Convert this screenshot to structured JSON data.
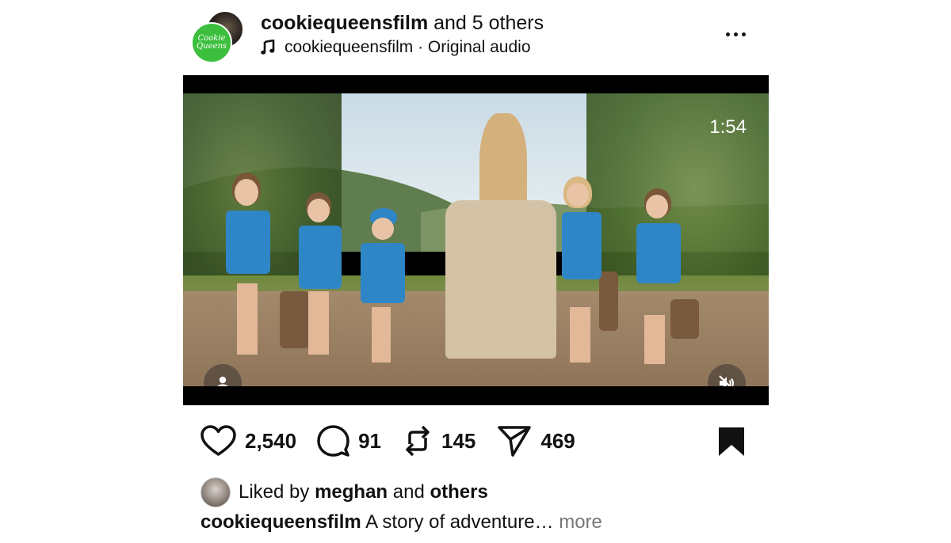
{
  "post": {
    "author": "cookiequeensfilm",
    "collab_suffix": "and 5 others",
    "audio_text": "cookiequeensfilm · Original audio",
    "brand_avatar_text": "Cookie Queens",
    "menu_icon": "more-horizontal-icon"
  },
  "video": {
    "duration": "1:54",
    "profile_icon": "person-icon",
    "mute_icon": "speaker-muted-icon"
  },
  "actions": {
    "likes": "2,540",
    "comments": "91",
    "reposts": "145",
    "shares": "469"
  },
  "liked_by": {
    "prefix": "Liked by",
    "user": "meghan",
    "middle": "and",
    "others": "others"
  },
  "caption": {
    "author": "cookiequeensfilm",
    "text": "A story of adventure…",
    "more": "more"
  },
  "colors": {
    "brand_green": "#3cbf3c",
    "text": "#111111",
    "muted": "#777777",
    "vest_blue": "#2f86c6"
  }
}
